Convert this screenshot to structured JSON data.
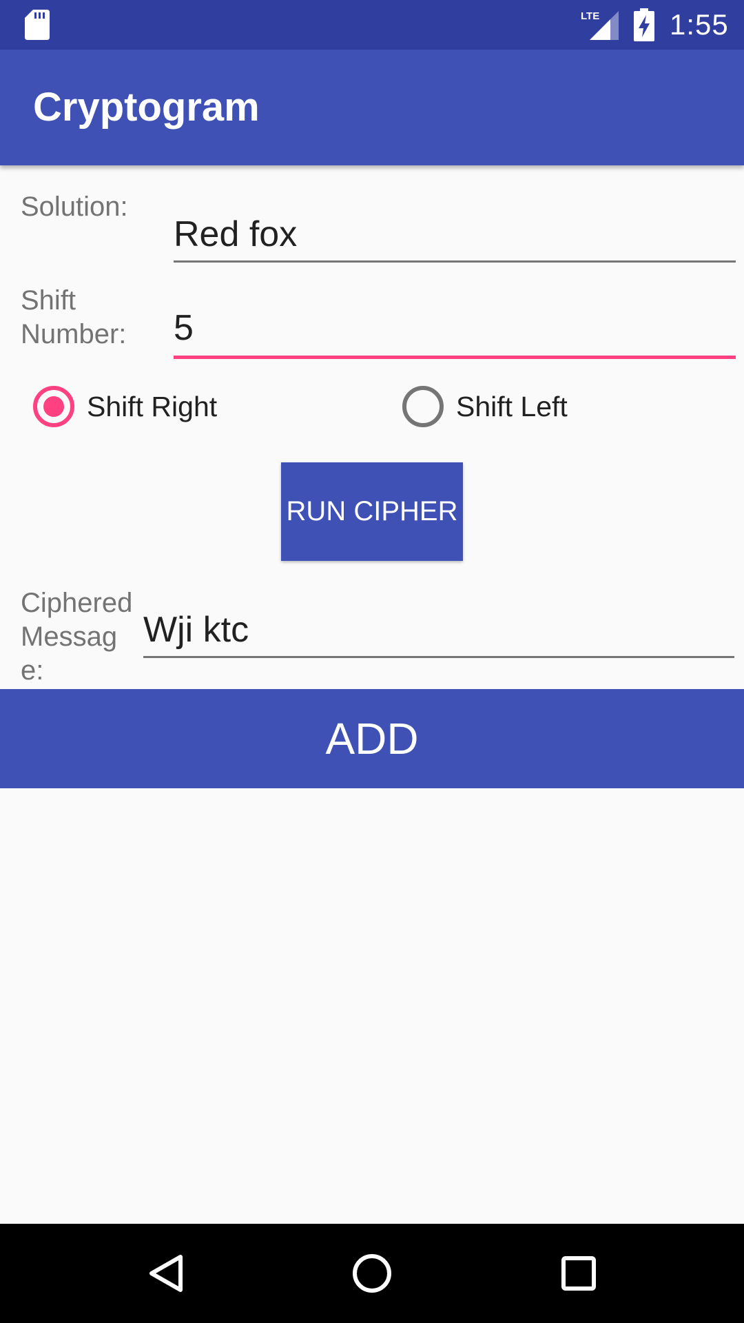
{
  "status_bar": {
    "time": "1:55",
    "icons": [
      "sd-card-icon",
      "lte-signal-icon",
      "battery-charging-icon"
    ]
  },
  "app_bar": {
    "title": "Cryptogram"
  },
  "form": {
    "solution_label": "Solution:",
    "solution_value": "Red fox",
    "shift_label_line1": "Shift",
    "shift_label_line2": "Number:",
    "shift_value": "5",
    "radio_right_label": "Shift Right",
    "radio_right_checked": true,
    "radio_left_label": "Shift Left",
    "radio_left_checked": false,
    "run_button_label": "RUN CIPHER",
    "ciphered_label_line1": "Ciphered",
    "ciphered_label_line2": "Messag",
    "ciphered_label_line3": "e:",
    "ciphered_value": "Wji ktc"
  },
  "add_button_label": "ADD",
  "nav_bar": {
    "icons": [
      "back-icon",
      "home-icon",
      "recents-icon"
    ]
  },
  "colors": {
    "primary": "#3F51B5",
    "primary_dark": "#303F9F",
    "accent": "#FF4081",
    "background": "#FAFAFA"
  }
}
